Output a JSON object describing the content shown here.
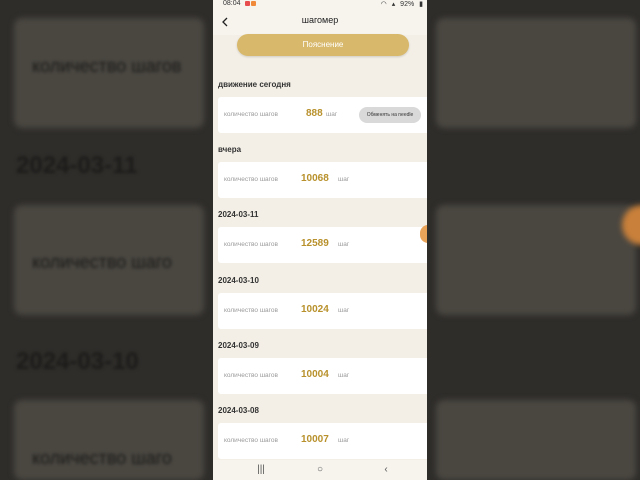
{
  "status": {
    "time": "08:04",
    "battery": "92%",
    "notif_colors": [
      "#e84d4d",
      "#f08a3a"
    ]
  },
  "header": {
    "back_icon": "chevron-left-icon",
    "title": "шагомер"
  },
  "explain_button": "Пояснение",
  "today": {
    "section": "движение сегодня",
    "label": "количество шагов",
    "value": "888",
    "unit": "шаг",
    "exchange_button": "Обменять на needle"
  },
  "days": [
    {
      "section": "вчера",
      "label": "количество шагов",
      "value": "10068",
      "unit": "шаг"
    },
    {
      "section": "2024-03-11",
      "label": "количество шагов",
      "value": "12589",
      "unit": "шаг"
    },
    {
      "section": "2024-03-10",
      "label": "количество шагов",
      "value": "10024",
      "unit": "шаг"
    },
    {
      "section": "2024-03-09",
      "label": "количество шагов",
      "value": "10004",
      "unit": "шаг"
    },
    {
      "section": "2024-03-08",
      "label": "количество шагов",
      "value": "10007",
      "unit": "шаг"
    }
  ],
  "navbar": {
    "recents": "|||",
    "home": "○",
    "back": "‹"
  },
  "background": {
    "text1": "количество шагов",
    "date1": "2024-03-11",
    "text2": "количество шаго",
    "date2": "2024-03-10",
    "text3": "количество шаго"
  },
  "colors": {
    "accent": "#d8b86a",
    "value": "#b8912c",
    "screen_bg": "#f3efe6"
  }
}
